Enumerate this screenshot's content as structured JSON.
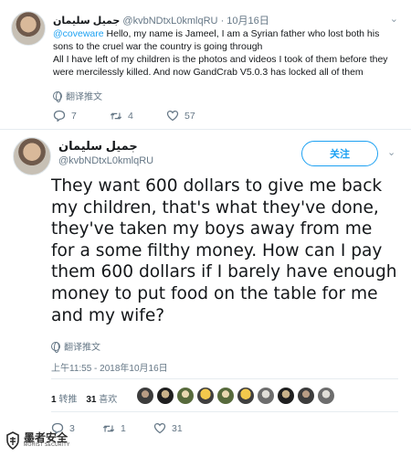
{
  "reply_tweet": {
    "name": "جميل سليمان",
    "handle": "@kvbNDtxL0kmlqRU",
    "date": "· 10月16日",
    "mention": "@coveware",
    "text": " Hello, my name is Jameel, I am a Syrian father who lost both his sons to the cruel war the country is going through\nAll I have left of my children is the photos and videos I took of them before they were mercilessly killed. And now GandCrab V5.0.3 has locked all of them",
    "translate_label": "翻译推文",
    "reply_count": "7",
    "retweet_count": "4",
    "like_count": "57"
  },
  "main_tweet": {
    "name": "جميل سليمان",
    "handle": "@kvbNDtxL0kmlqRU",
    "follow_label": "关注",
    "text": "They want 600 dollars to give me back my children, that's what they've done, they've taken my boys away from me for a some filthy money. How can I pay them 600 dollars if I barely have enough money to put food on the table for me and my wife?",
    "translate_label": "翻译推文",
    "timestamp": "上午11:55 - 2018年10月16日",
    "retweets_num": "1",
    "retweets_label": "转推",
    "likes_num": "31",
    "likes_label": "喜欢",
    "reply_count": "3",
    "retweet_count": "1",
    "like_count": "31"
  },
  "watermark": {
    "cn": "墨者安全",
    "en": "MOHIST SECURITY"
  },
  "icons": {
    "reply": "reply-icon",
    "retweet": "retweet-icon",
    "like": "heart-icon",
    "chevron": "chevron-down-icon",
    "translate": "globe-icon"
  },
  "colors": {
    "accent": "#1da1f2",
    "muted": "#657786",
    "text": "#14171a"
  }
}
